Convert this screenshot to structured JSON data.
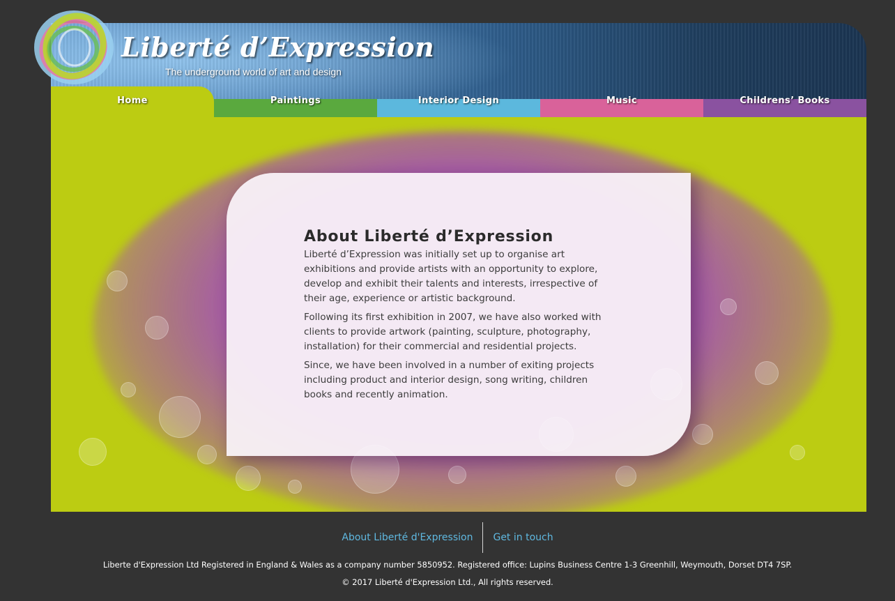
{
  "brand": {
    "title": "Liberté d’Expression",
    "tagline": "The underground world of art and design",
    "logo_icon": "paint-swirl-logo-icon"
  },
  "nav": {
    "items": [
      {
        "label": "Home",
        "color": "#bccc12",
        "active": true
      },
      {
        "label": "Paintings",
        "color": "#5aa93e"
      },
      {
        "label": "Interior  Design",
        "color": "#5cb8dd"
      },
      {
        "label": "Music",
        "color": "#d9629a"
      },
      {
        "label": "Childrens’  Books",
        "color": "#8a52a0"
      }
    ]
  },
  "main": {
    "heading": "About  Liberté  d’Expression",
    "paragraphs": [
      "Liberté d’Expression was initially set up to organise art exhibitions and provide artists with an opportunity to explore, develop and exhibit their talents and interests, irrespective of their age, experience or artistic background.",
      "Following its first exhibition in 2007, we have also worked with clients to provide artwork (painting, sculpture, photography, installation) for their commercial and residential projects.",
      "Since, we have been involved in a number of exiting projects including product and interior design, song writing, children books and recently animation."
    ]
  },
  "footer": {
    "links": [
      "About Liberté d'Expression",
      "Get in touch"
    ],
    "registration": "Liberte d'Expression Ltd Registered in England & Wales as a company number 5850952. Registered office: Lupins Business Centre 1-3 Greenhill, Weymouth, Dorset DT4 7SP.",
    "copyright": "© 2017 Liberté d'Expression Ltd., All rights reserved."
  },
  "colors": {
    "page_bg": "#333333",
    "lime": "#bccc12",
    "purple": "#a456ac",
    "link_blue": "#5fb8e0"
  }
}
